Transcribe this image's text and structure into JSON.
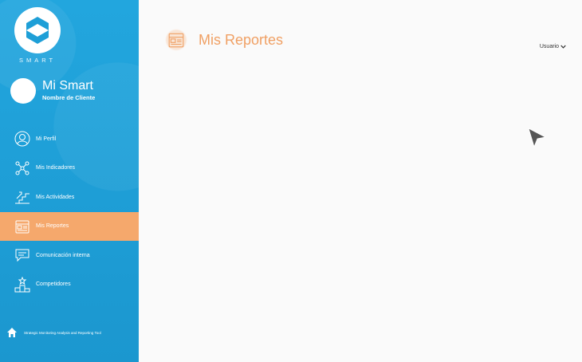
{
  "brand": {
    "wordmark": "SMART",
    "app_name": "Mi Smart",
    "client_name": "Nombre de Cliente"
  },
  "nav": {
    "items": [
      {
        "label": "Mi Perfil",
        "icon": "user-icon"
      },
      {
        "label": "Mis Indicadores",
        "icon": "network-icon"
      },
      {
        "label": "Mis Actividades",
        "icon": "stairs-icon"
      },
      {
        "label": "Mis Reportes",
        "icon": "report-icon",
        "active": true
      },
      {
        "label": "Comunicación interna",
        "icon": "chat-icon"
      },
      {
        "label": "Competidores",
        "icon": "podium-icon"
      }
    ]
  },
  "footer": {
    "text": "Strategic Monitoring Analysis and Reporting Tool",
    "icon": "home-icon"
  },
  "header": {
    "title": "Mis Reportes",
    "icon": "report-icon"
  },
  "user_menu": {
    "label": "Usuario",
    "icon": "chevron-down-icon"
  },
  "colors": {
    "sidebar": "#1e9fd7",
    "accent": "#f5a86c",
    "title": "#f0a064",
    "background": "#fafafa"
  }
}
